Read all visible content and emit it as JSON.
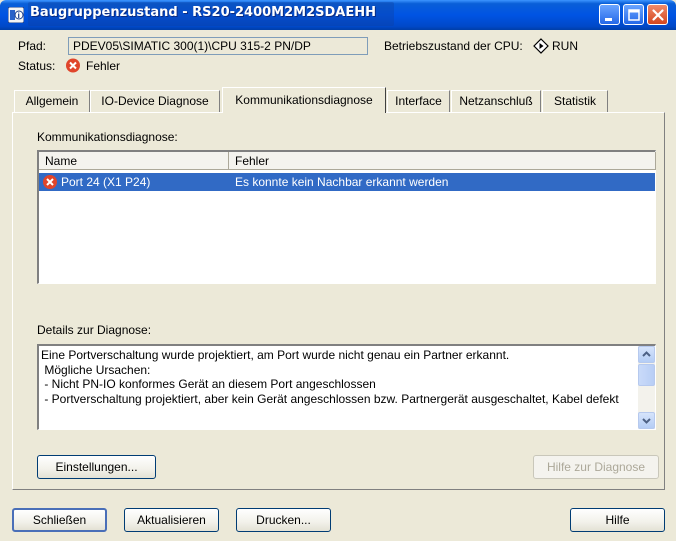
{
  "window": {
    "title": "Baugruppenzustand - RS20-2400M2M2SDAEHH"
  },
  "header": {
    "path_label": "Pfad:",
    "path_value": "PDEV05\\SIMATIC 300(1)\\CPU 315-2 PN/DP",
    "cpu_state_label": "Betriebszustand der CPU:",
    "cpu_state_value": "RUN",
    "status_label": "Status:",
    "status_value": "Fehler"
  },
  "tabs": [
    {
      "label": "Allgemein"
    },
    {
      "label": "IO-Device Diagnose"
    },
    {
      "label": "Kommunikationsdiagnose",
      "active": true
    },
    {
      "label": "Interface"
    },
    {
      "label": "Netzanschluß"
    },
    {
      "label": "Statistik"
    }
  ],
  "comm": {
    "section_label": "Kommunikationsdiagnose:",
    "columns": [
      "Name",
      "Fehler"
    ],
    "rows": [
      {
        "name": "Port 24 (X1 P24)",
        "error": "Es konnte kein Nachbar erkannt werden",
        "selected": true
      }
    ]
  },
  "details": {
    "label": "Details zur Diagnose:",
    "text": "Eine Portverschaltung wurde projektiert, am Port wurde nicht genau ein Partner erkannt.\n Mögliche Ursachen:\n - Nicht PN-IO konformes Gerät an diesem Port angeschlossen\n - Portverschaltung projektiert, aber kein Gerät angeschlossen bzw. Partnergerät ausgeschaltet, Kabel defekt"
  },
  "buttons": {
    "settings": "Einstellungen...",
    "help_diag": "Hilfe zur Diagnose",
    "close": "Schließen",
    "refresh": "Aktualisieren",
    "print": "Drucken...",
    "help": "Hilfe"
  },
  "colors": {
    "titlebar": "#0054e3",
    "selection": "#316ac5",
    "error_icon": "#e0452b"
  },
  "icons": {
    "app": "module-diagnose-icon",
    "cpu_state": "run-state-icon",
    "status": "error-icon",
    "row": "error-icon"
  }
}
